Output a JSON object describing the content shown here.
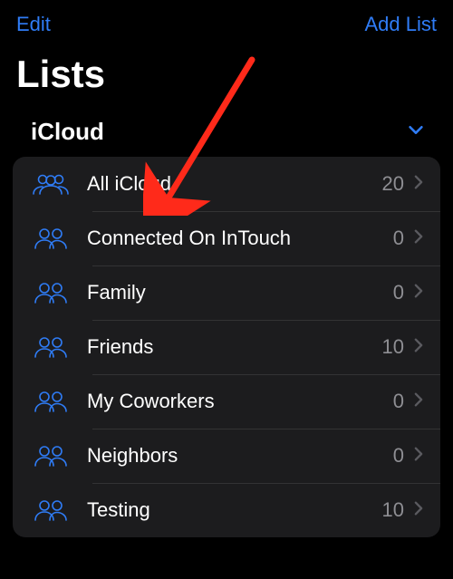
{
  "toolbar": {
    "edit_label": "Edit",
    "add_list_label": "Add List"
  },
  "page_title": "Lists",
  "account": {
    "name": "iCloud"
  },
  "lists": [
    {
      "name": "All iCloud",
      "count": 20,
      "icon_variant": "three"
    },
    {
      "name": "Connected On InTouch",
      "count": 0,
      "icon_variant": "two"
    },
    {
      "name": "Family",
      "count": 0,
      "icon_variant": "two"
    },
    {
      "name": "Friends",
      "count": 10,
      "icon_variant": "two"
    },
    {
      "name": "My Coworkers",
      "count": 0,
      "icon_variant": "two"
    },
    {
      "name": "Neighbors",
      "count": 0,
      "icon_variant": "two"
    },
    {
      "name": "Testing",
      "count": 10,
      "icon_variant": "two"
    }
  ],
  "colors": {
    "accent": "#2f7cf6",
    "arrow": "#ff2a1a"
  }
}
